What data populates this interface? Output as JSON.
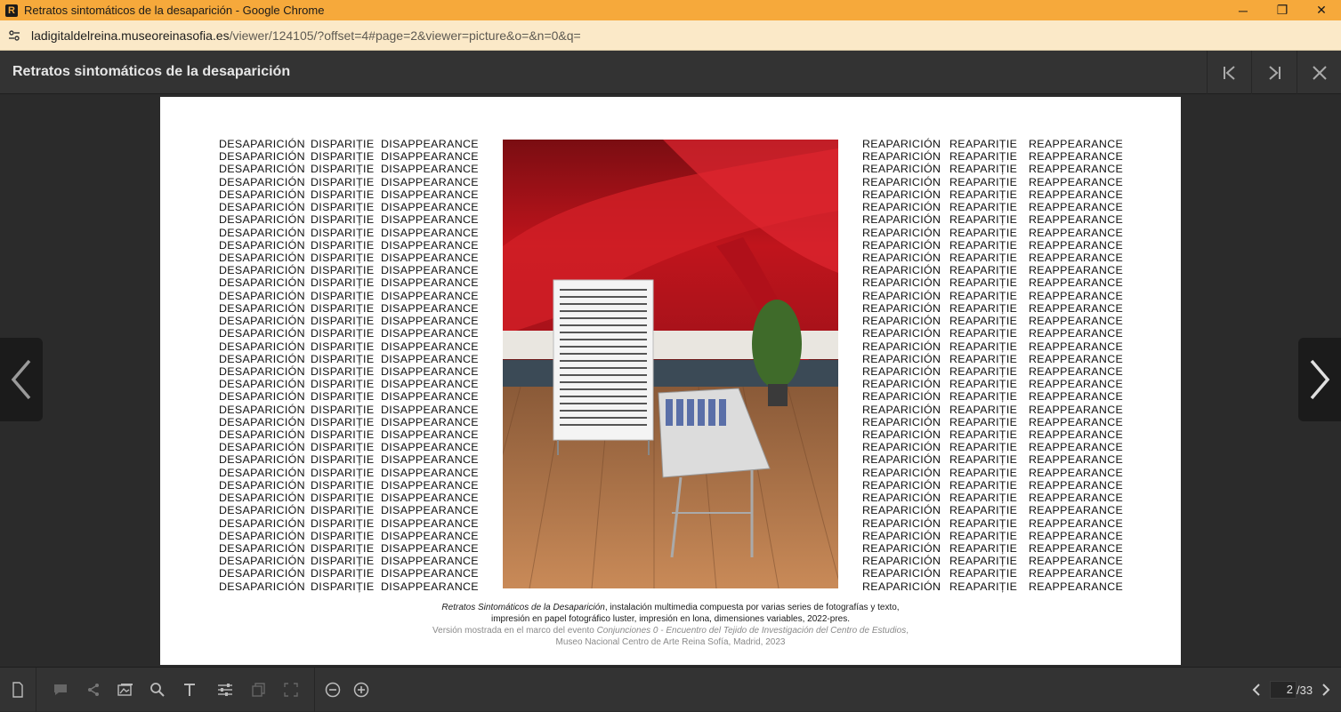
{
  "browser": {
    "window_title": "Retratos sintomáticos de la desaparición - Google Chrome",
    "app_icon_letter": "R",
    "url_host": "ladigitaldelreina.museoreinasofia.es",
    "url_path": "/viewer/124105/?offset=4#page=2&viewer=picture&o=&n=0&q=",
    "controls": {
      "minimize": "─",
      "restore": "❐",
      "close": "✕"
    }
  },
  "viewer": {
    "title": "Retratos sintomáticos de la desaparición",
    "header_buttons": [
      "first-page-icon",
      "last-page-icon",
      "close-icon"
    ]
  },
  "page": {
    "left_words": [
      "DESAPARICIÓN",
      "DISPARIȚIE",
      "DISAPPEARANCE"
    ],
    "right_words": [
      "REAPARICIÓN",
      "REAPARIȚIE",
      "REAPPEARANCE"
    ],
    "rows": 36,
    "caption": {
      "line1_italic": "Retratos Sintomáticos de la Desaparición",
      "line1_rest": ", instalación multimedia compuesta por varias series de fotografías y texto,",
      "line2": "impresión en papel fotográfico luster, impresión en lona, dimensiones variables, 2022-pres.",
      "line3_prefix": "Versión mostrada en el marco del evento ",
      "line3_italic": "Conjunciones 0 - Encuentro del Tejido de Investigación del Centro de Estudios",
      "line3_suffix": ",",
      "line4": "Museo Nacional Centro de Arte Reina Sofía, Madrid, 2023"
    }
  },
  "toolbar": {
    "tools": [
      "page-icon",
      "comment-icon",
      "share-icon",
      "image-icon",
      "search-icon",
      "text-icon",
      "settings-sliders-icon",
      "copy-icon",
      "fullscreen-icon",
      "zoom-out-icon",
      "zoom-in-icon"
    ],
    "current_page": "2",
    "total_pages": "/33"
  },
  "colors": {
    "titlebar": "#f6a93b",
    "addressbar": "#fbe9c8",
    "viewer_bg": "#2b2b2b",
    "panel": "#333333"
  }
}
